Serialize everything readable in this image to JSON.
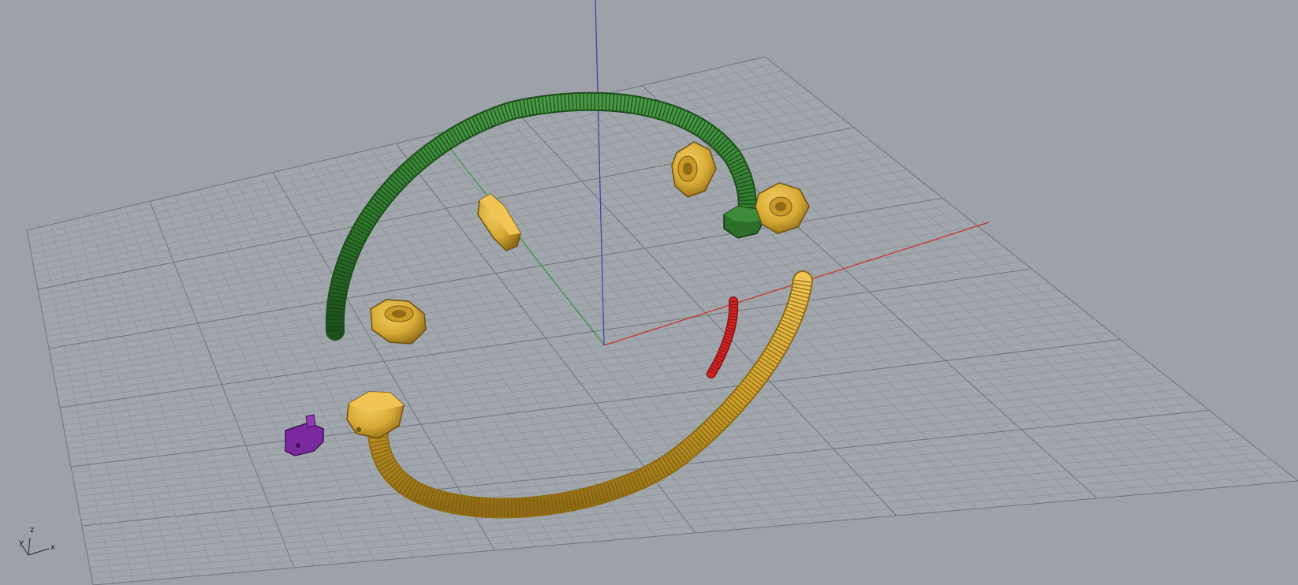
{
  "viewport": {
    "name": "Perspective",
    "background_color": "#9ca2a8",
    "grid_color": "#8a9096",
    "grid_major_color": "#6f757b"
  },
  "axes": {
    "x_color": "#c8302c",
    "y_color": "#3b9a3b",
    "z_color": "#3a3ab4"
  },
  "gizmo": {
    "x_label": "x",
    "y_label": "y",
    "z_label": "z"
  },
  "objects": [
    {
      "name": "green-threaded-rod",
      "color": "#2f7a2c"
    },
    {
      "name": "green-hex-nut",
      "color": "#2d6e2a"
    },
    {
      "name": "yellow-threaded-rod",
      "color": "#d1a32c"
    },
    {
      "name": "yellow-hex-nut-1",
      "color": "#d6a935"
    },
    {
      "name": "yellow-hex-nut-2",
      "color": "#d6a935"
    },
    {
      "name": "yellow-hex-nut-3",
      "color": "#d6a935"
    },
    {
      "name": "yellow-hex-nut-4",
      "color": "#d6a935"
    },
    {
      "name": "yellow-end-block",
      "color": "#d6a935"
    },
    {
      "name": "red-rod-segment",
      "color": "#d42424"
    },
    {
      "name": "purple-bracket",
      "color": "#7a2a9e"
    }
  ]
}
